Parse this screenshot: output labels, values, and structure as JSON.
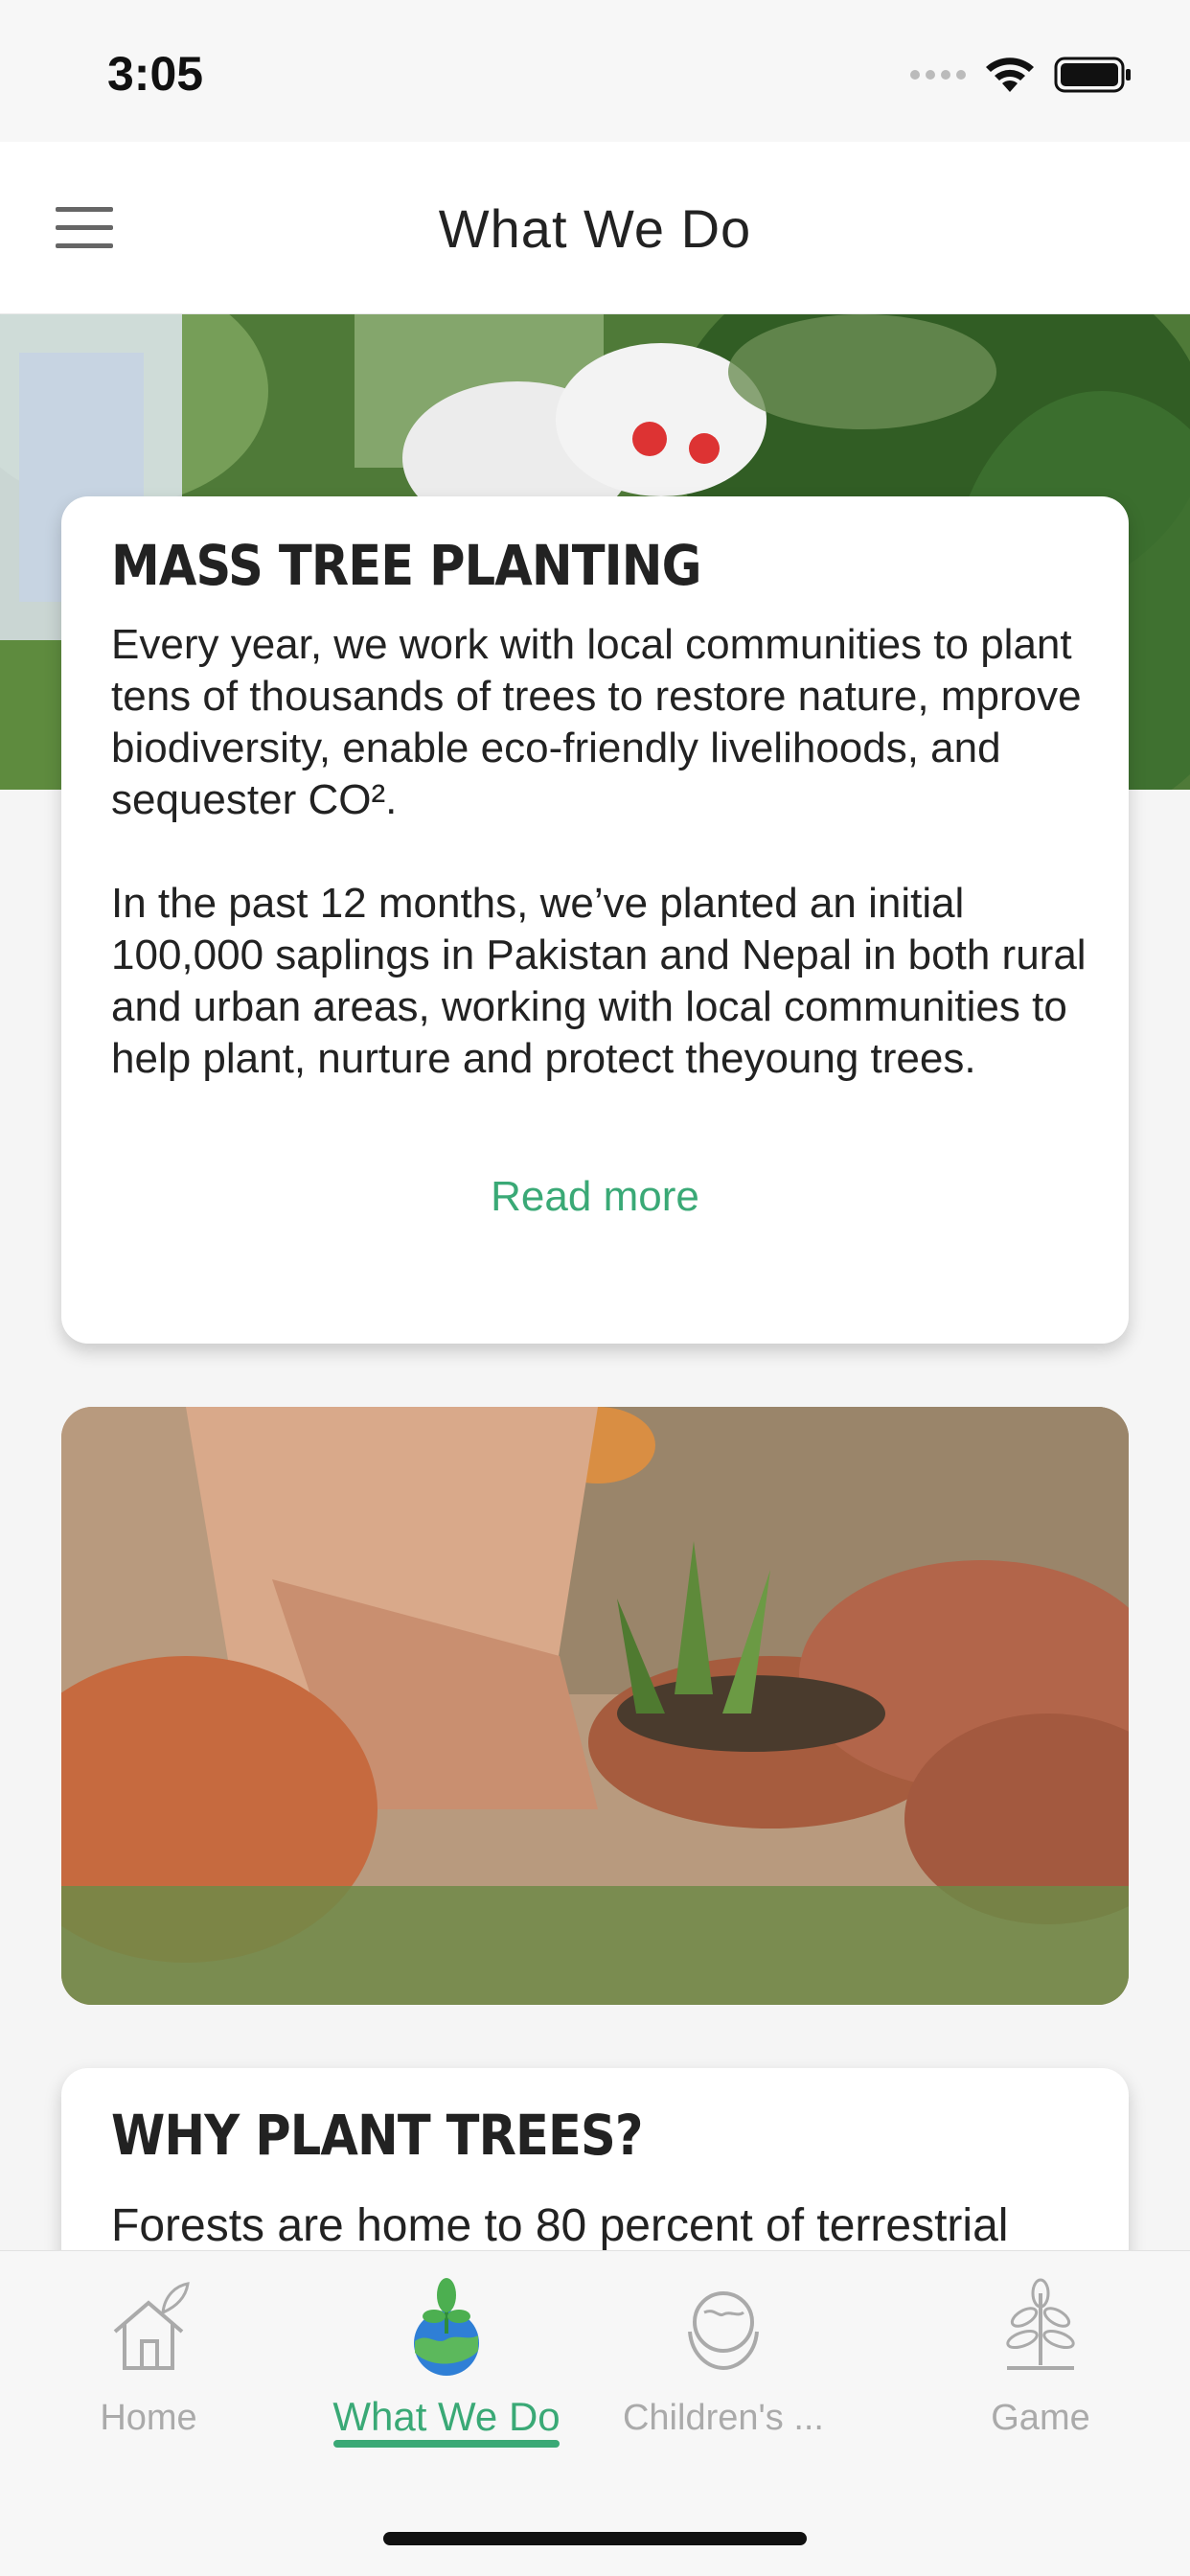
{
  "status_bar": {
    "time": "3:05"
  },
  "header": {
    "title": "What We Do"
  },
  "card1": {
    "title": "MASS TREE PLANTING",
    "paragraph1": "Every year, we work with local communities to plant tens of thousands of trees to restore nature, mprove biodiversity, enable eco-friendly livelihoods, and sequester CO².",
    "paragraph2": " In the past 12 months, we’ve planted an initial 100,000 saplings in Pakistan and Nepal in both rural and urban areas, working with local communities to help plant, nurture and protect theyoung trees.",
    "read_more": "Read more"
  },
  "card3": {
    "title": "WHY PLANT TREES?",
    "paragraph1": "Forests are home to 80 percent of terrestrial"
  },
  "tabs": [
    {
      "label": "Home",
      "icon": "home-icon",
      "active": false
    },
    {
      "label": "What We Do",
      "icon": "sapling-globe-icon",
      "active": true
    },
    {
      "label": "Children's ...",
      "icon": "globe-hands-icon",
      "active": false
    },
    {
      "label": "Game",
      "icon": "plant-icon",
      "active": false
    }
  ],
  "colors": {
    "accent": "#3aa976",
    "inactive": "#aaaaaa"
  }
}
